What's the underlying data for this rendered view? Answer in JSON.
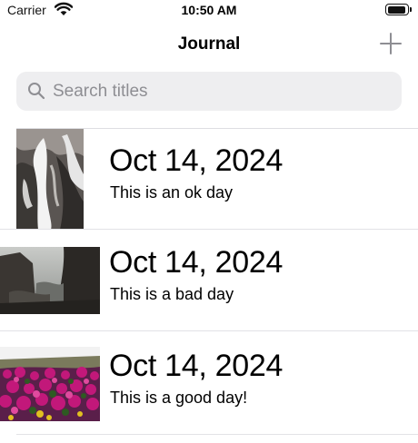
{
  "status_bar": {
    "carrier": "Carrier",
    "time": "10:50 AM",
    "battery_level": 0.95
  },
  "nav": {
    "title": "Journal",
    "add_icon": "plus-icon"
  },
  "search": {
    "placeholder": "Search titles",
    "value": "",
    "icon": "magnifier-icon"
  },
  "entries": [
    {
      "date": "Oct 14, 2024",
      "title": "This is an ok day",
      "image": "waterfall-photo"
    },
    {
      "date": "Oct 14, 2024",
      "title": "This is a bad day",
      "image": "misty-canyon-photo"
    },
    {
      "date": "Oct 14, 2024",
      "title": "This is a good day!",
      "image": "flower-field-photo"
    }
  ],
  "colors": {
    "accent": "#8e8e93",
    "search_background": "#eeeef0",
    "divider": "#dedee2"
  }
}
